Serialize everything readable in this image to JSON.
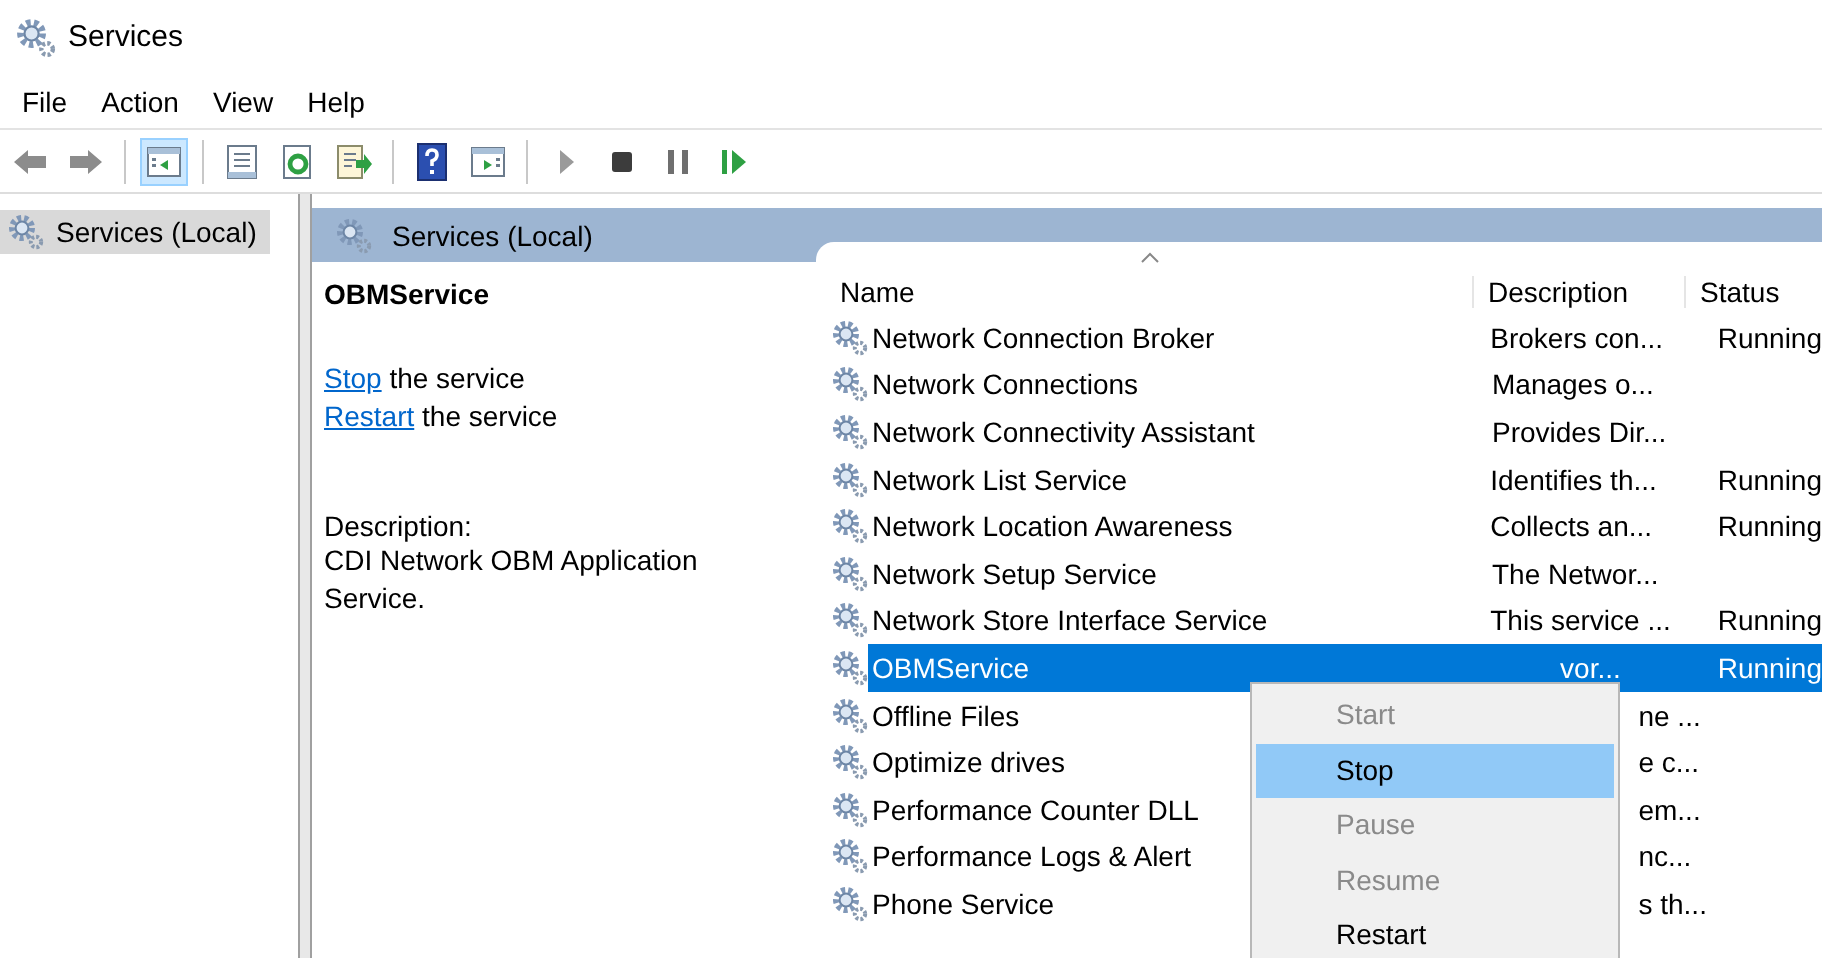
{
  "window": {
    "title": "Services"
  },
  "menu_bar": [
    "File",
    "Action",
    "View",
    "Help"
  ],
  "toolbar": [
    {
      "kind": "back",
      "pressed": false
    },
    {
      "kind": "forward",
      "pressed": false
    },
    {
      "kind": "separator"
    },
    {
      "kind": "console-tree",
      "pressed": true
    },
    {
      "kind": "separator"
    },
    {
      "kind": "properties",
      "pressed": false
    },
    {
      "kind": "refresh",
      "pressed": false
    },
    {
      "kind": "export",
      "pressed": false
    },
    {
      "kind": "separator"
    },
    {
      "kind": "help",
      "pressed": false
    },
    {
      "kind": "action-pane",
      "pressed": false
    },
    {
      "kind": "separator"
    },
    {
      "kind": "start",
      "pressed": false
    },
    {
      "kind": "stop",
      "pressed": false
    },
    {
      "kind": "pause",
      "pressed": false
    },
    {
      "kind": "resume",
      "pressed": false
    }
  ],
  "tree": [
    {
      "label": "Services (Local)",
      "selected": true
    }
  ],
  "pane_header": "Services (Local)",
  "details": {
    "name": "OBMService",
    "actions": [
      {
        "link": "Stop",
        "text": " the service"
      },
      {
        "link": "Restart",
        "text": " the service"
      }
    ],
    "description_label": "Description:",
    "description": "CDI Network OBM Application Service."
  },
  "table": {
    "columns": [
      "Name",
      "Description",
      "Status"
    ],
    "rows": [
      {
        "name": "Network Connection Broker",
        "description": "Brokers con...",
        "status": "Running",
        "selected": false,
        "covered": false
      },
      {
        "name": "Network Connections",
        "description": "Manages o...",
        "selected": false,
        "covered": false
      },
      {
        "name": "Network Connectivity Assistant",
        "description": "Provides Dir...",
        "selected": false,
        "covered": false
      },
      {
        "name": "Network List Service",
        "description": "Identifies th...",
        "status": "Running",
        "selected": false,
        "covered": false
      },
      {
        "name": "Network Location Awareness",
        "description": "Collects an...",
        "status": "Running",
        "selected": false,
        "covered": false
      },
      {
        "name": "Network Setup Service",
        "description": "The Networ...",
        "selected": false,
        "covered": false
      },
      {
        "name": "Network Store Interface Service",
        "description": "This service ...",
        "status": "Running",
        "selected": false,
        "covered": false
      },
      {
        "name": "OBMService",
        "description": "vor...",
        "status": "Running",
        "selected": true,
        "covered": true
      },
      {
        "name": "Offline Files",
        "description": "ne ...",
        "selected": false,
        "covered": true
      },
      {
        "name": "Optimize drives",
        "description": "e c...",
        "selected": false,
        "covered": true
      },
      {
        "name": "Performance Counter DLL",
        "description": "em...",
        "selected": false,
        "covered": true
      },
      {
        "name": "Performance Logs & Alert",
        "description": "nc...",
        "selected": false,
        "covered": true
      },
      {
        "name": "Phone Service",
        "description": "s th...",
        "selected": false,
        "covered": true
      }
    ]
  },
  "context_menu": [
    {
      "label": "Start",
      "disabled": true,
      "selected": false
    },
    {
      "label": "Stop",
      "disabled": false,
      "selected": true
    },
    {
      "label": "Pause",
      "disabled": true,
      "selected": false
    },
    {
      "label": "Resume",
      "disabled": true,
      "selected": false
    },
    {
      "label": "Restart",
      "disabled": false,
      "selected": false
    }
  ]
}
